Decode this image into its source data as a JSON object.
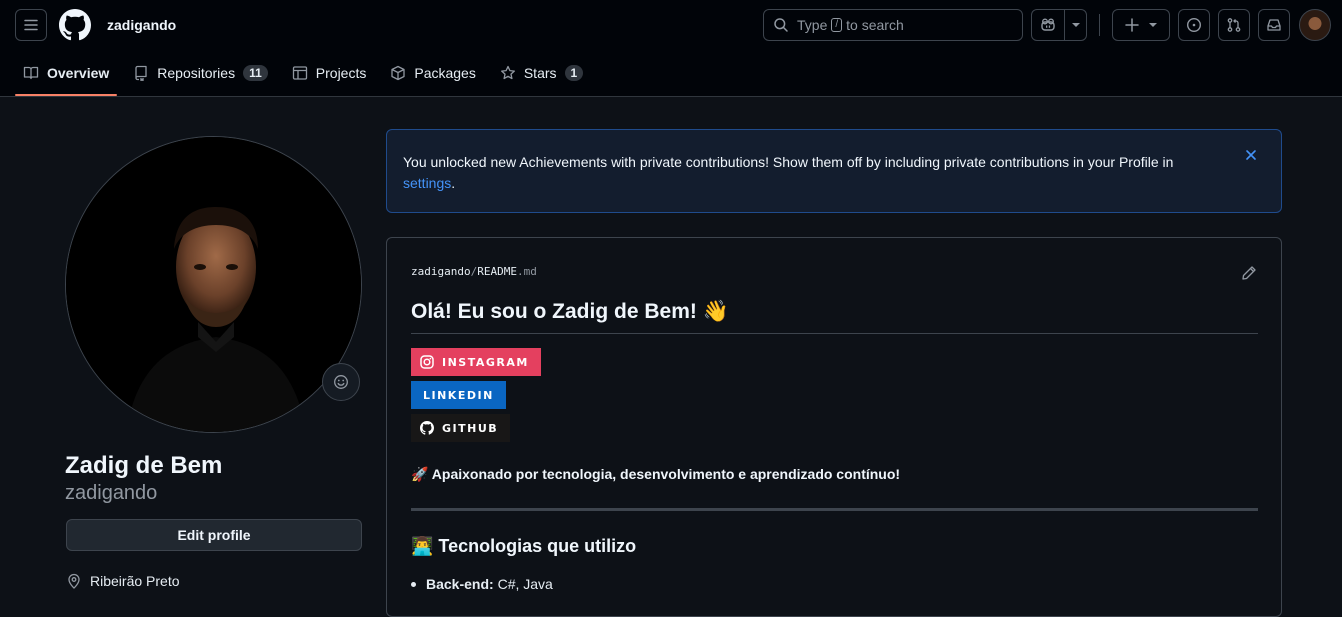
{
  "header": {
    "username": "zadigando",
    "search": {
      "prefix": "Type",
      "key": "/",
      "suffix": "to search"
    }
  },
  "tabs": [
    {
      "label": "Overview",
      "active": true
    },
    {
      "label": "Repositories",
      "count": "11"
    },
    {
      "label": "Projects"
    },
    {
      "label": "Packages"
    },
    {
      "label": "Stars",
      "count": "1"
    }
  ],
  "profile": {
    "full_name": "Zadig de Bem",
    "login": "zadigando",
    "edit_label": "Edit profile",
    "location": "Ribeirão Preto"
  },
  "banner": {
    "text": "You unlocked new Achievements with private contributions! Show them off by including private contributions in your Profile in",
    "link": "settings",
    "after": "."
  },
  "readme": {
    "owner": "zadigando",
    "sep": "/",
    "file_base": "README",
    "file_ext": ".md",
    "heading": "Olá! Eu sou o Zadig de Bem! 👋",
    "badges": {
      "instagram": "INSTAGRAM",
      "linkedin": "LINKEDIN",
      "github": "GITHUB"
    },
    "tagline": "🚀 Apaixonado por tecnologia, desenvolvimento e aprendizado contínuo!",
    "tech_heading": "👨‍💻 Tecnologias que utilizo",
    "items": [
      {
        "label": "Back-end:",
        "value": "C#, Java"
      }
    ]
  },
  "colors": {
    "accent_tab": "#f78166",
    "link": "#4493f8",
    "instagram": "#e4405f",
    "linkedin": "#0a66c2",
    "github_badge": "#181717"
  }
}
